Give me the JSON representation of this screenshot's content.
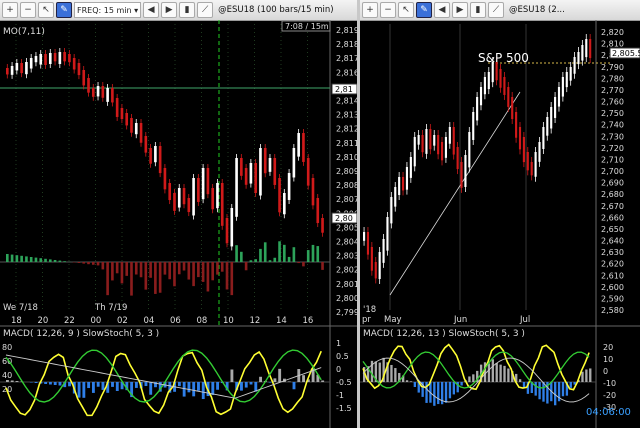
{
  "left_window": {
    "toolbar": {
      "freq_label": "FREQ: 15 min",
      "symbol_title": "@ESU18 (100 bars/15 min)"
    },
    "chart": {
      "indicator_label": "MO(7,11)",
      "cursor_readout": "7:08 / 15m",
      "price_axis": [
        "2,819",
        "2,818",
        "2,817",
        "2,816",
        "2,815",
        "2,814",
        "2,813",
        "2,812",
        "2,811",
        "2,810",
        "2,809",
        "2,808",
        "2,807",
        "2,806",
        "2,805",
        "2,804",
        "2,803",
        "2,802",
        "2,801",
        "2,800",
        "2,799"
      ],
      "time_axis": [
        "18",
        "20",
        "22",
        "00",
        "02",
        "04",
        "06",
        "08",
        "10",
        "12",
        "14",
        "16"
      ],
      "day_labels": [
        "We 7/18",
        "Th 7/19"
      ],
      "price_marker_1": "2,81",
      "price_marker_2": "2,80",
      "macd_label": "MACD( 12,26, 9 ) SlowStoch( 5, 3 )",
      "macd_axis": [
        "1",
        "0.5",
        "0",
        "-0.5",
        "-1",
        "-1.5"
      ],
      "stoch_axis": [
        "80",
        "60",
        "40",
        "20"
      ]
    }
  },
  "right_window": {
    "toolbar": {
      "symbol_title": "@ESU18 (2..."
    },
    "chart": {
      "annotation": "S&P 500",
      "last_price_marker": "2,805.5",
      "price_axis": [
        "2,820",
        "2,810",
        "2,800",
        "2,790",
        "2,780",
        "2,770",
        "2,760",
        "2,750",
        "2,740",
        "2,730",
        "2,720",
        "2,710",
        "2,700",
        "2,690",
        "2,680",
        "2,670",
        "2,660",
        "2,650",
        "2,640",
        "2,630",
        "2,620",
        "2,610",
        "2,600",
        "2,590",
        "2,580"
      ],
      "time_axis": [
        "pr",
        "May",
        "Jun",
        "Jul"
      ],
      "year_label": "'18",
      "macd_label": "MACD( 12,26, 13 ) SlowStoch( 5, 3 )",
      "macd_axis": [
        "20",
        "10",
        "0",
        "-10",
        "-20",
        "-30"
      ],
      "countdown": "04:06:00"
    }
  },
  "colors": {
    "up_bar": "#ffffff",
    "down_bar": "#d11a1a",
    "stoch_k": "#ffff33",
    "stoch_d": "#33cc33",
    "macd_hist_neg": "#2f7fe8",
    "macd_hist_pos": "#aaaaaa",
    "dashed_cursor": "#22cc22"
  }
}
